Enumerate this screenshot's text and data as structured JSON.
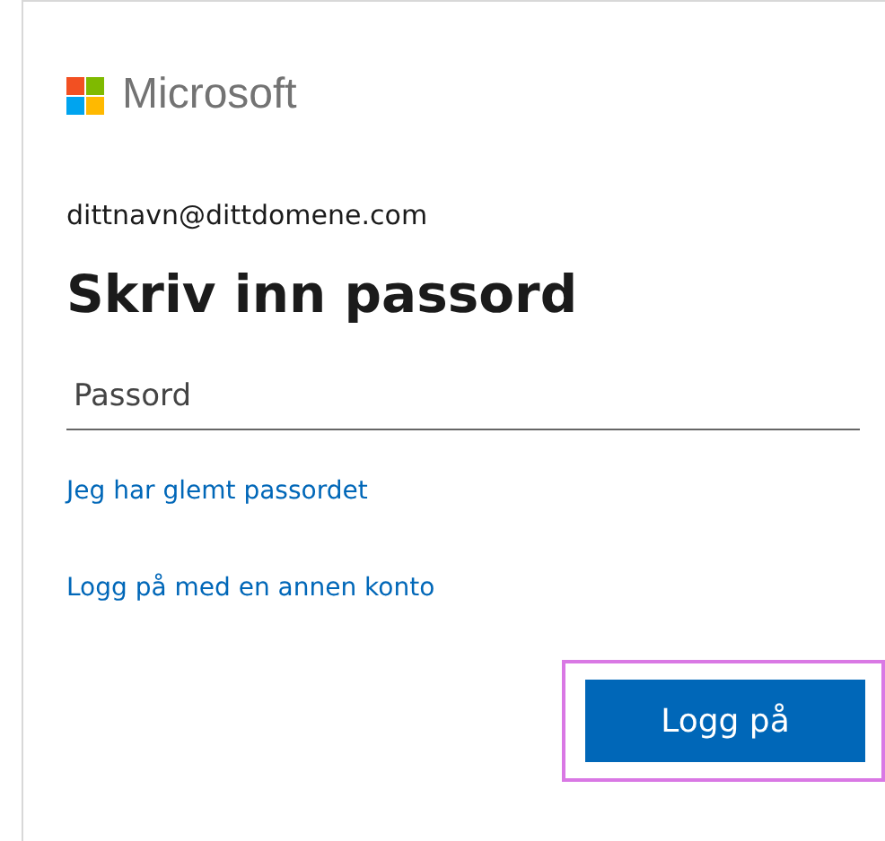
{
  "logo": {
    "text": "Microsoft"
  },
  "account": "dittnavn@dittdomene.com",
  "heading": "Skriv inn passord",
  "password": {
    "placeholder": "Passord"
  },
  "links": [
    {
      "label": "Jeg har glemt passordet"
    },
    {
      "label": "Logg på med en annen konto"
    }
  ],
  "submit": {
    "label": "Logg på",
    "highlighted": true
  }
}
